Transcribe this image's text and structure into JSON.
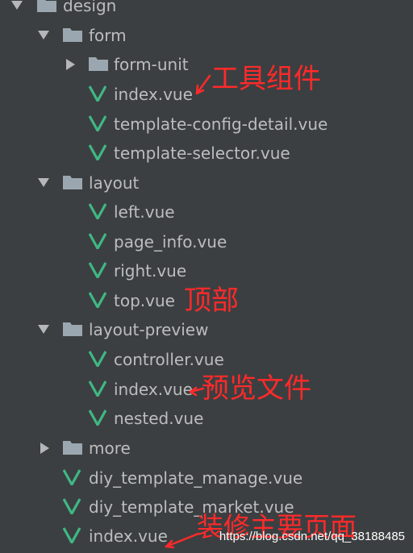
{
  "colors": {
    "background": "#3c3f41",
    "text": "#bbbdbe",
    "folder": "#9aa7b0",
    "vue_icon": "#3fb884",
    "annotation": "#ff2a2a"
  },
  "tree": {
    "design": {
      "name": "design",
      "icon": "folder-icon"
    },
    "form": {
      "name": "form",
      "icon": "folder-icon"
    },
    "form_unit": {
      "name": "form-unit",
      "icon": "folder-icon"
    },
    "form_index": {
      "name": "index.vue",
      "icon": "vue-icon"
    },
    "template_config_detail": {
      "name": "template-config-detail.vue",
      "icon": "vue-icon"
    },
    "template_selector": {
      "name": "template-selector.vue",
      "icon": "vue-icon"
    },
    "layout": {
      "name": "layout",
      "icon": "folder-icon"
    },
    "left": {
      "name": "left.vue",
      "icon": "vue-icon"
    },
    "page_info": {
      "name": "page_info.vue",
      "icon": "vue-icon"
    },
    "right": {
      "name": "right.vue",
      "icon": "vue-icon"
    },
    "top": {
      "name": "top.vue",
      "icon": "vue-icon"
    },
    "layout_preview": {
      "name": "layout-preview",
      "icon": "folder-icon"
    },
    "controller": {
      "name": "controller.vue",
      "icon": "vue-icon"
    },
    "preview_index": {
      "name": "index.vue",
      "icon": "vue-icon"
    },
    "nested": {
      "name": "nested.vue",
      "icon": "vue-icon"
    },
    "more": {
      "name": "more",
      "icon": "folder-icon"
    },
    "diy_template_manage": {
      "name": "diy_template_manage.vue",
      "icon": "vue-icon"
    },
    "diy_template_market": {
      "name": "diy_template_market.vue",
      "icon": "vue-icon"
    },
    "root_index": {
      "name": "index.vue",
      "icon": "vue-icon"
    }
  },
  "annotations": {
    "tool_component": "工具组件",
    "top_part": "顶部",
    "preview_file": "预览文件",
    "main_page": "装修主要页面"
  },
  "watermark": "https://blog.csdn.net/qq_38188485"
}
